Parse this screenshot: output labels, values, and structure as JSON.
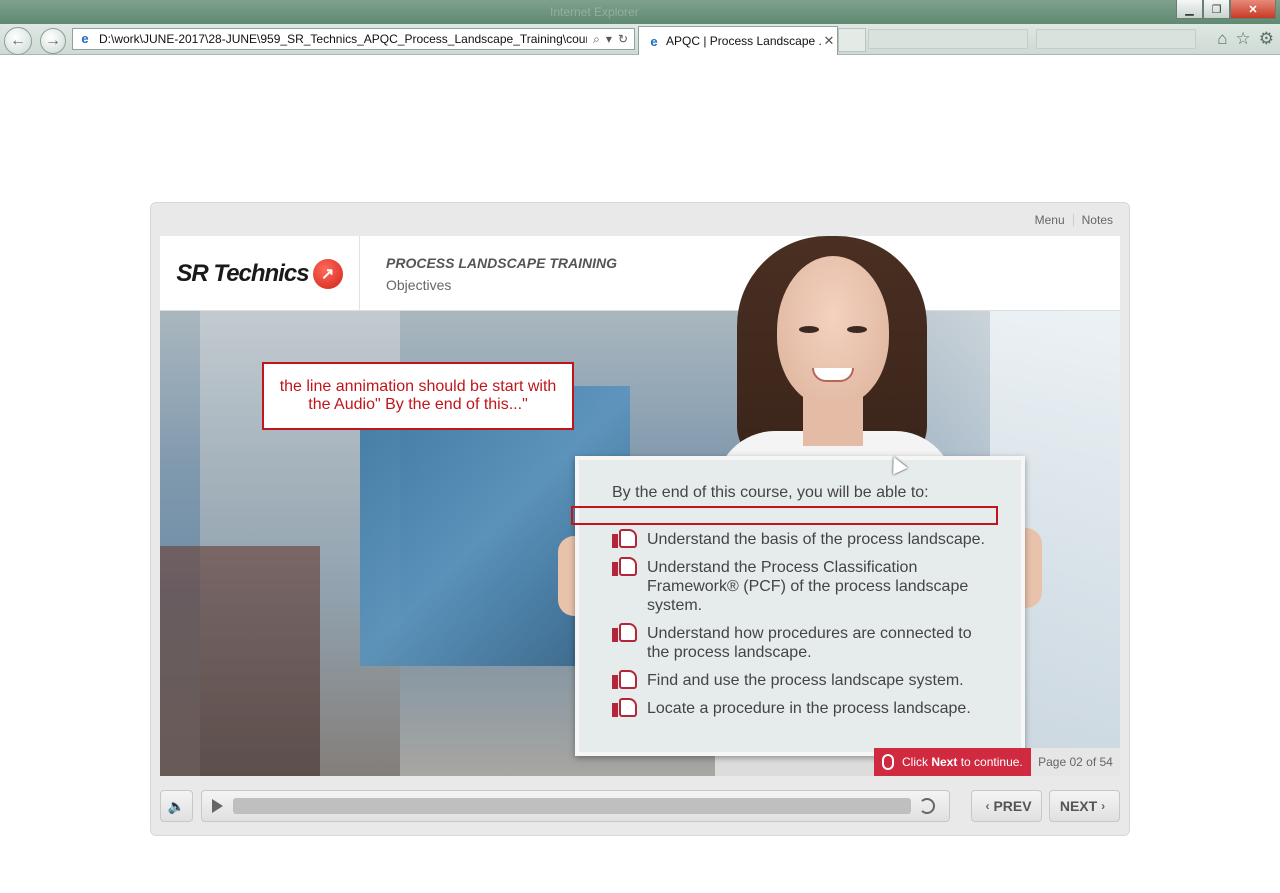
{
  "browser": {
    "window_title": "Internet Explorer",
    "address": "D:\\work\\JUNE-2017\\28-JUNE\\959_SR_Technics_APQC_Process_Landscape_Training\\course\\",
    "tab_title": "APQC | Process Landscape ...",
    "buttons": {
      "back": "←",
      "forward": "→",
      "minimize": "▁",
      "restore": "❐",
      "close": "✕",
      "tab_close": "✕",
      "search": "⌕",
      "dropdown": "▾",
      "refresh": "↻",
      "home": "⌂",
      "favorites": "☆",
      "settings": "⚙"
    }
  },
  "player": {
    "menu_label": "Menu",
    "notes_label": "Notes",
    "logo_text": "SR Technics",
    "logo_mark": "↗",
    "course_title": "PROCESS LANDSCAPE TRAINING",
    "page_title": "Objectives",
    "review_note": "the line annimation should be start with the Audio\" By the end of this...\"",
    "intro": "By the end of this course, you will be able to:",
    "objectives": [
      "Understand the basis of the process landscape.",
      "Understand the Process Classification Framework® (PCF) of the process landscape system.",
      "Understand how procedures are connected to the process landscape.",
      "Find and use the process landscape system.",
      "Locate a procedure in the process landscape."
    ],
    "cta_prefix": "Click ",
    "cta_bold": "Next",
    "cta_suffix": " to continue.",
    "page_indicator": "Page 02 of 54",
    "prev_label": "PREV",
    "next_label": "NEXT",
    "audio_icon": "🔈",
    "audio_progress": 0,
    "prev_chevron": "‹",
    "next_chevron": "›"
  }
}
